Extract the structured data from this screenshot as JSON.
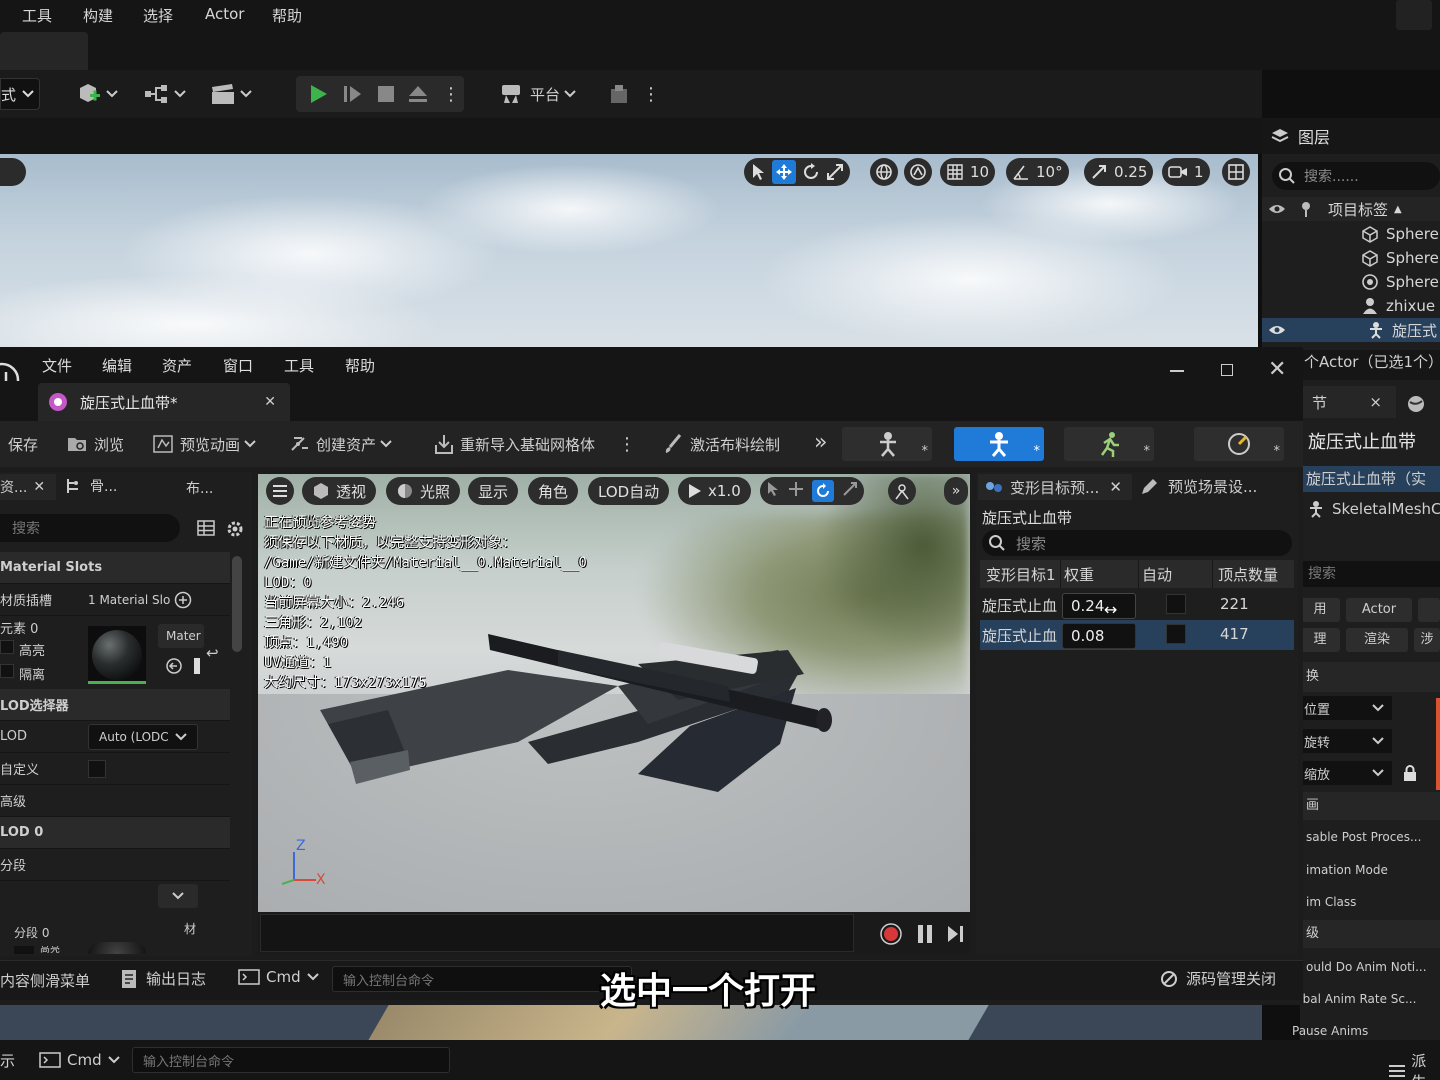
{
  "main_menu": [
    "工具",
    "构建",
    "选择",
    "Actor",
    "帮助"
  ],
  "main_toolbar": {
    "mode_fragment": "式",
    "platform_label": "平台"
  },
  "level_viewport": {
    "show_fragment": "示",
    "grid_snap": "10",
    "rotation_snap": "10°",
    "scale_snap": "0.25",
    "camera_speed": "1"
  },
  "outliner": {
    "title": "图层",
    "search_placeholder": "搜索......",
    "column_label": "项目标签",
    "items": [
      "Sphere",
      "Sphere",
      "Sphere",
      "zhixue",
      "旋压式"
    ]
  },
  "details_right": {
    "actor_count": "个Actor（已选1个）",
    "tab_label": "节",
    "actor_name": "旋压式止血带",
    "component_root": "旋压式止血带（实",
    "component_child": "SkeletalMeshC",
    "search_placeholder": "搜索",
    "filter_buttons": [
      "用",
      "Actor",
      "理",
      "渲染",
      "涉"
    ],
    "sections": [
      "换",
      "画",
      "级"
    ],
    "transform": [
      "位置",
      "旋转",
      "缩放"
    ],
    "props": [
      "sable Post Proces...",
      "imation Mode",
      "im Class",
      "ould Do Anim Noti...",
      "lobal Anim Rate Sc...",
      "Pause Anims"
    ]
  },
  "editor": {
    "menu": [
      "文件",
      "编辑",
      "资产",
      "窗口",
      "工具",
      "帮助"
    ],
    "tab_title": "旋压式止血带*",
    "toolbar": {
      "save": "保存",
      "browse": "浏览",
      "preview_anim": "预览动画",
      "create_asset": "创建资产",
      "reimport": "重新导入基础网格体",
      "cloth_paint": "激活布料绘制"
    },
    "left_panel": {
      "tabs": [
        "资...",
        "骨...",
        "布..."
      ],
      "search_placeholder": "搜索",
      "material_slots_header": "Material Slots",
      "material_slots_label": "材质插槽",
      "material_slots_value": "1 Material Slo",
      "element_label": "元素 0",
      "highlight_label": "高亮",
      "isolate_label": "隔离",
      "material_btn": "Mater",
      "lod_picker_header": "LOD选择器",
      "lod_label": "LOD",
      "lod_value": "Auto (LODC",
      "custom_label": "自定义",
      "advanced_label": "高级",
      "lod0_header": "LOD 0",
      "sections_label": "分段",
      "section0_label": "分段 0",
      "mat_label": "材",
      "highlight_label_2": "高亮"
    },
    "preview": {
      "toolbar": [
        "透视",
        "光照",
        "显示",
        "角色",
        "LOD自动"
      ],
      "playrate": "x1.0",
      "stats": [
        "正在预览参考姿势",
        "须保存以下材质，以完整支持变形对象：",
        "/Game/新建文件夹/Material__0.Material__0",
        "LOD：0",
        "当前屏幕大小：2.246",
        "三角形：2,102",
        "顶点：1,490",
        "UV通道：1",
        "大约尺寸：173x273x175"
      ],
      "axis_z": "Z",
      "axis_x": "X"
    },
    "morph_panel": {
      "tabs": [
        "变形目标预...",
        "预览场景设..."
      ],
      "asset_name": "旋压式止血带",
      "search_placeholder": "搜索",
      "columns": [
        "变形目标1",
        "权重",
        "自动",
        "顶点数量"
      ],
      "rows": [
        {
          "name": "旋压式止血",
          "weight": "0.24",
          "vertices": "221"
        },
        {
          "name": "旋压式止血",
          "weight": "0.08",
          "vertices": "417"
        }
      ]
    },
    "statusbar": {
      "content_drawer": "内容侧滑菜单",
      "output_log": "输出日志",
      "cmd": "Cmd",
      "console_placeholder": "输入控制台命令",
      "source_control": "源码管理关闭"
    }
  },
  "main_statusbar": {
    "fragment": "示",
    "cmd": "Cmd",
    "console_placeholder": "输入控制台命令",
    "derive": "派生"
  },
  "caption": "选中一个打开"
}
